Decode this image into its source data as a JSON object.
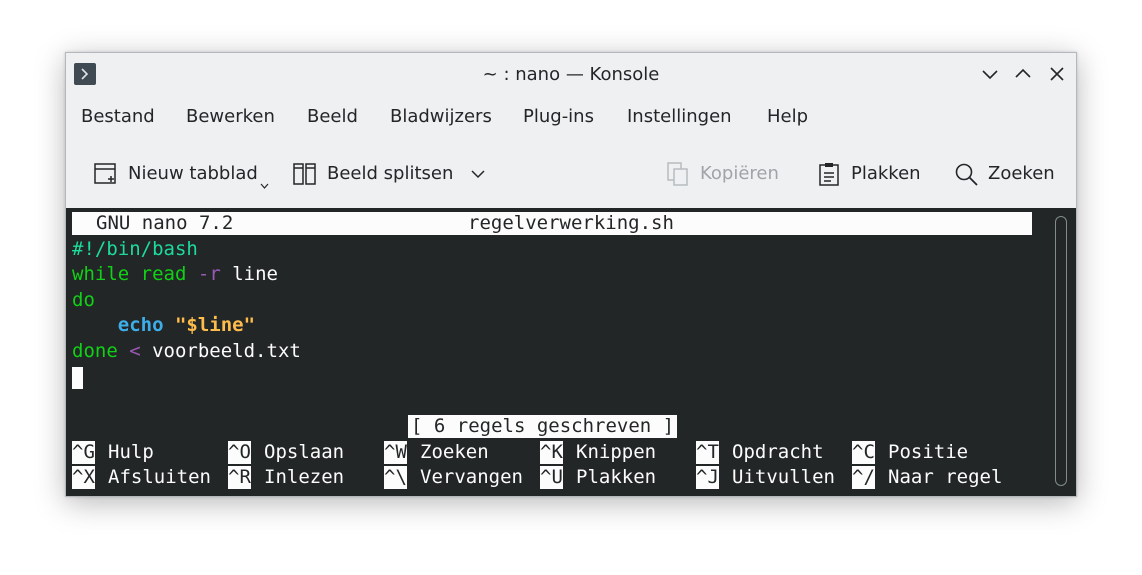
{
  "window": {
    "title": "~ : nano — Konsole"
  },
  "menubar": {
    "items": [
      "Bestand",
      "Bewerken",
      "Beeld",
      "Bladwijzers",
      "Plug-ins",
      "Instellingen",
      "Help"
    ]
  },
  "toolbar": {
    "new_tab": "Nieuw tabblad",
    "split_view": "Beeld splitsen",
    "copy": "Kopiëren",
    "paste": "Plakken",
    "search": "Zoeken"
  },
  "nano": {
    "version": "GNU nano 7.2",
    "filename": "regelverwerking.sh",
    "lines": [
      [
        {
          "t": "#!/bin/bash",
          "c": "c-green"
        }
      ],
      [
        {
          "t": "while",
          "c": "c-kw"
        },
        {
          "t": " "
        },
        {
          "t": "read",
          "c": "c-kw"
        },
        {
          "t": " "
        },
        {
          "t": "-r",
          "c": "c-purple"
        },
        {
          "t": " line"
        }
      ],
      [
        {
          "t": "do",
          "c": "c-kw"
        }
      ],
      [
        {
          "t": "    "
        },
        {
          "t": "echo",
          "c": "c-blue"
        },
        {
          "t": " "
        },
        {
          "t": "\"$line\"",
          "c": "c-orange"
        }
      ],
      [
        {
          "t": "done",
          "c": "c-kw"
        },
        {
          "t": " "
        },
        {
          "t": "<",
          "c": "c-purple"
        },
        {
          "t": " voorbeeld.txt"
        }
      ]
    ],
    "status": "[ 6 regels geschreven ]",
    "shortcuts_row1": [
      {
        "key": "^G",
        "label": "Hulp"
      },
      {
        "key": "^O",
        "label": "Opslaan"
      },
      {
        "key": "^W",
        "label": "Zoeken"
      },
      {
        "key": "^K",
        "label": "Knippen"
      },
      {
        "key": "^T",
        "label": "Opdracht"
      },
      {
        "key": "^C",
        "label": "Positie"
      }
    ],
    "shortcuts_row2": [
      {
        "key": "^X",
        "label": "Afsluiten"
      },
      {
        "key": "^R",
        "label": "Inlezen"
      },
      {
        "key": "^\\",
        "label": "Vervangen"
      },
      {
        "key": "^U",
        "label": "Plakken"
      },
      {
        "key": "^J",
        "label": "Uitvullen"
      },
      {
        "key": "^/",
        "label": "Naar regel"
      }
    ]
  },
  "colors": {
    "terminal_bg": "#232627",
    "terminal_fg": "#fcfcfc",
    "comment": "#1cdc9a",
    "keyword": "#11d116",
    "operator": "#9b59b6",
    "builtin": "#3daee9",
    "string": "#fdbc4b"
  }
}
